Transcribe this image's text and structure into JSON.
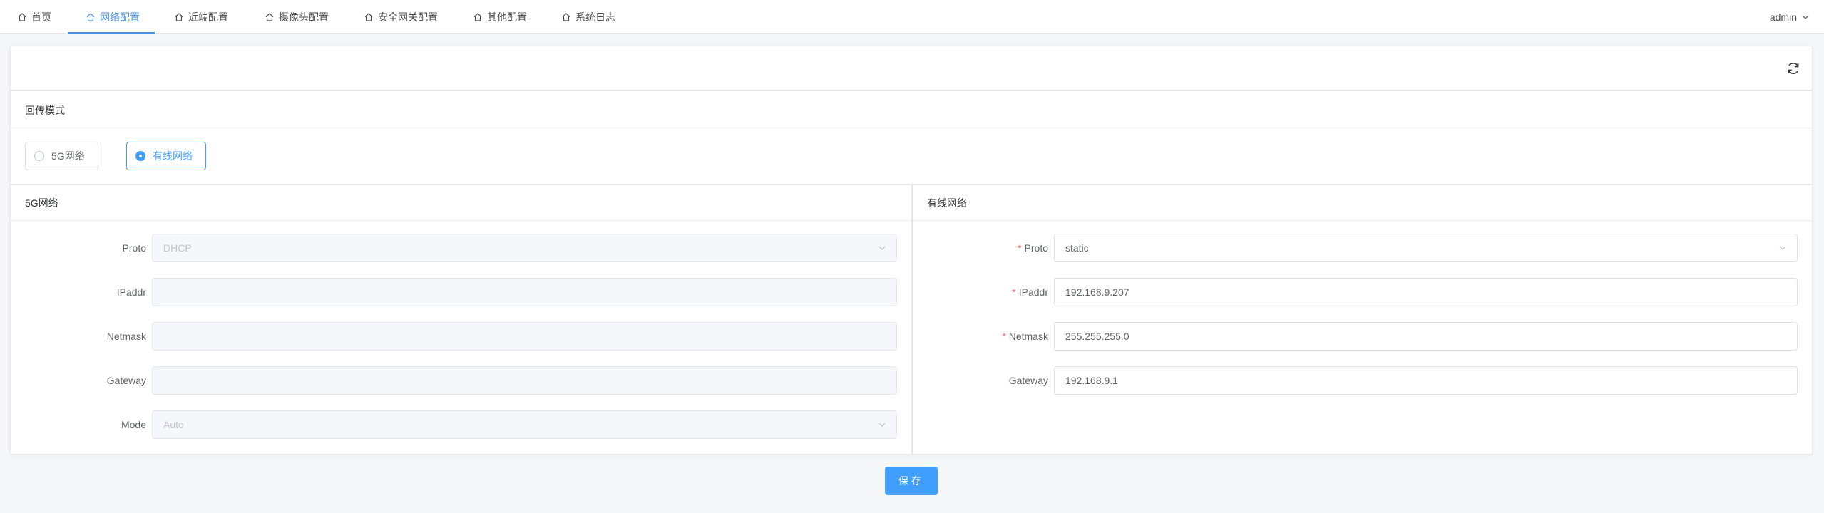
{
  "nav": {
    "tabs": [
      {
        "label": "首页",
        "icon": "home-icon",
        "active": false
      },
      {
        "label": "网络配置",
        "icon": "home-icon",
        "active": true
      },
      {
        "label": "近端配置",
        "icon": "home-icon",
        "active": false
      },
      {
        "label": "摄像头配置",
        "icon": "home-icon",
        "active": false
      },
      {
        "label": "安全网关配置",
        "icon": "home-icon",
        "active": false
      },
      {
        "label": "其他配置",
        "icon": "home-icon",
        "active": false
      },
      {
        "label": "系统日志",
        "icon": "home-icon",
        "active": false
      }
    ],
    "user": "admin"
  },
  "backhaul": {
    "title": "回传模式",
    "options": [
      {
        "label": "5G网络",
        "checked": false
      },
      {
        "label": "有线网络",
        "checked": true
      }
    ]
  },
  "panel_5g": {
    "title": "5G网络",
    "fields": [
      {
        "label": "Proto",
        "value": "DHCP",
        "type": "select",
        "disabled": true,
        "required": false
      },
      {
        "label": "IPaddr",
        "value": "",
        "type": "input",
        "disabled": true,
        "required": false
      },
      {
        "label": "Netmask",
        "value": "",
        "type": "input",
        "disabled": true,
        "required": false
      },
      {
        "label": "Gateway",
        "value": "",
        "type": "input",
        "disabled": true,
        "required": false
      },
      {
        "label": "Mode",
        "value": "Auto",
        "type": "select",
        "disabled": true,
        "required": false
      }
    ]
  },
  "panel_wired": {
    "title": "有线网络",
    "fields": [
      {
        "label": "Proto",
        "value": "static",
        "type": "select",
        "disabled": false,
        "required": true
      },
      {
        "label": "IPaddr",
        "value": "192.168.9.207",
        "type": "input",
        "disabled": false,
        "required": true
      },
      {
        "label": "Netmask",
        "value": "255.255.255.0",
        "type": "input",
        "disabled": false,
        "required": true
      },
      {
        "label": "Gateway",
        "value": "192.168.9.1",
        "type": "input",
        "disabled": false,
        "required": false
      }
    ]
  },
  "actions": {
    "save_label": "保存"
  },
  "colors": {
    "accent": "#409eff",
    "nav_active": "#4a90e2",
    "required": "#f56c6c"
  }
}
